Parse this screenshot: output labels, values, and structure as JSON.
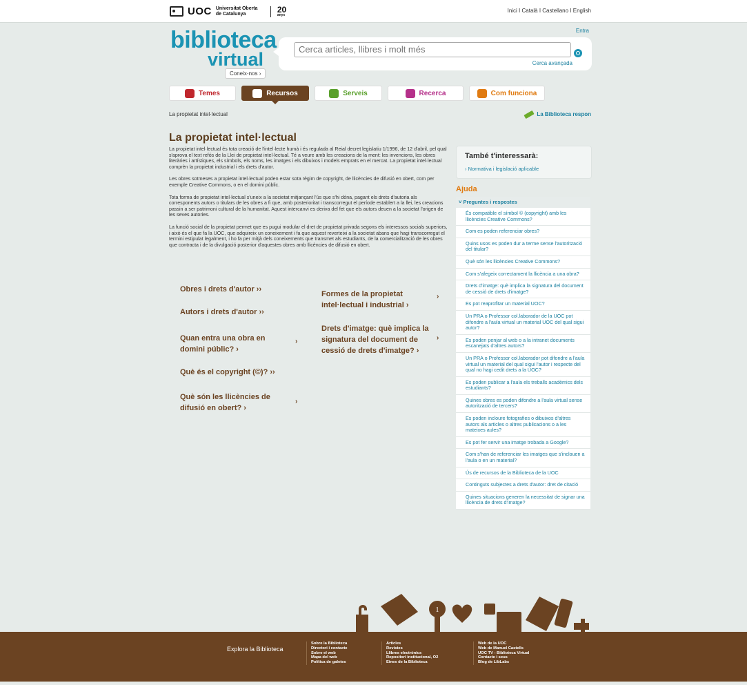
{
  "topbar": {
    "logo_text": "UOC",
    "university_name": "Universitat Oberta de Catalunya",
    "anniversary": "20",
    "anniversary_sub": "anys",
    "languages": "Inici I Català I Castellano I English"
  },
  "header": {
    "brand_line1": "biblioteca",
    "brand_line2": "virtual",
    "coneix_label": "Coneix-nos ›",
    "entra_label": "Entra",
    "search_placeholder": "Cerca articles, llibres i molt més",
    "advanced_search": "Cerca avançada"
  },
  "nav": {
    "tabs": [
      {
        "label": "Temes",
        "icon": "temes-icon",
        "color": "#c0272d"
      },
      {
        "label": "Recursos",
        "icon": "recursos-icon",
        "color": "#6b4322"
      },
      {
        "label": "Serveis",
        "icon": "serveis-icon",
        "color": "#5aa02c"
      },
      {
        "label": "Recerca",
        "icon": "recerca-icon",
        "color": "#b5308a"
      },
      {
        "label": "Com funciona",
        "icon": "com-funciona-icon",
        "color": "#e07b12"
      }
    ]
  },
  "breadcrumb": "La propietat intel·lectual",
  "biblioteca_respon": "La Biblioteca respon",
  "main": {
    "title": "La propietat intel·lectual",
    "paragraphs": [
      "La propietat intel·lectual és tota creació de l'intel·lecte humà i és regulada al Reial decret legislatiu 1/1996, de 12 d'abril, pel qual s'aprova el text refós de la Llei de propietat intel·lectual. Té a veure amb les creacions de la ment: les invencions, les obres literàries i artístiques, els símbols, els noms, les imatges i els dibuixos i models emprats en el mercat. La propietat intel·lectual comprèn la propietat industrial i els drets d'autor.",
      "Les obres sotmeses a propietat intel·lectual poden estar sota règim de copyright, de llicències de difusió en obert, com per exemple Creative Commons, o en el domini públic.",
      "Tota forma de propietat intel·lectual s'uneix a la societat mitjançant l'ús que s'hi dóna, pagant els drets d'autoria als corresponents autors o titulars de les obres a fi que, amb posterioritat i transcorregut el període establert a la llei, les creacions passin a ser patrimoni cultural de la humanitat. Aquest intercanvi es deriva del fet que els autors deuen a la societat l'origen de les seves autories.",
      "La funció social de la propietat permet que es pugui modular el dret de propietat privada segons els interessos socials superiors, i això és el que fa la UOC, que adquireix un coneixement i fa que aquest reverteixi a la societat abans que hagi transcorregut el termini estipulat legalment, i ho fa per mitjà dels coneixements que transmet als estudiants, de la comercialització de les obres que contracta i de la divulgació posterior d'aquestes obres amb llicències de difusió en obert."
    ],
    "links": [
      {
        "line1": "Obres i drets d'autor ››",
        "line2": ""
      },
      {
        "line1": "Autors i drets d'autor ››",
        "line2": ""
      },
      {
        "line1": "Quan entra una obra en",
        "line2": "domini públic? ›"
      },
      {
        "line1": "Què és el copyright (©)? ››",
        "line2": ""
      },
      {
        "line1": "Què són les llicències de",
        "line2": "difusió en obert? ›"
      },
      {
        "line1": "Formes de la propietat",
        "line2": "intel·lectual i industrial ›"
      },
      {
        "line1": "Drets d'imatge: què implica la",
        "line2": "signatura del document de",
        "line3": "cessió de drets d'imatge? ›"
      }
    ]
  },
  "sidebar": {
    "also_title": "També t'interessarà:",
    "also_link": "› Normativa i legislació aplicable",
    "ajuda_title": "Ajuda",
    "faq_header": "˅ Preguntes i respostes",
    "faq": [
      "És compatible el símbol © (copyright) amb les llicències Creative Commons?",
      "Com es poden referenciar obres?",
      "Quins usos es poden dur a terme sense l'autorització del titular?",
      "Què són les llicències Creative Commons?",
      "Com s'afegeix correctament la llicència a una obra?",
      "Drets d'imatge: què implica la signatura del document de cessió de drets d'imatge?",
      "Es pot reaprofitar un material UOC?",
      "Un PRA o Professor col.laborador de la UOC pot difondre a l'aula virtual un material UOC del qual sigui autor?",
      "Es poden penjar al web o a la intranet documents escanejats d'altres autors?",
      "Un PRA o Professor col.laborador pot difondre a l'aula virtual un material del qual sigui l'autor i respecte del qual no hagi cedit drets a la UOC?",
      "Es poden publicar a l'aula els treballs acadèmics dels estudiants?",
      "Quines obres es poden difondre a l'aula virtual sense autorització de tercers?",
      "Es poden incloure fotografies o dibuixos d'altres autors als articles o altres publicacions o a les mateixes aules?",
      "Es pot fer servir una imatge trobada a Google?",
      "Com s'han de referenciar les imatges que s'inclouen a l'aula o en un material?",
      "Ús de recursos de la Biblioteca de la UOC",
      "Continguts subjectes a drets d'autor: dret de citació",
      "Quines situacions generen la necessitat de signar una llicència de drets d'imatge?"
    ]
  },
  "footer": {
    "explore_label": "Explora la Biblioteca",
    "col1": [
      "Sobre la Biblioteca",
      "Directori i contacte",
      "Sobre el web",
      "Mapa del web",
      "Política de galetes"
    ],
    "col2": [
      "Articles",
      "Revistes",
      "Llibres electrònics",
      "Repositori institucional, O2",
      "Eines de la Biblioteca"
    ],
    "col3": [
      "Web de la UOC",
      "Web de Manuel Castells",
      "UOC TV - Biblioteca Virtual",
      "Contacte i seus",
      "Blog de LibLabs"
    ],
    "badge_number": "1"
  }
}
